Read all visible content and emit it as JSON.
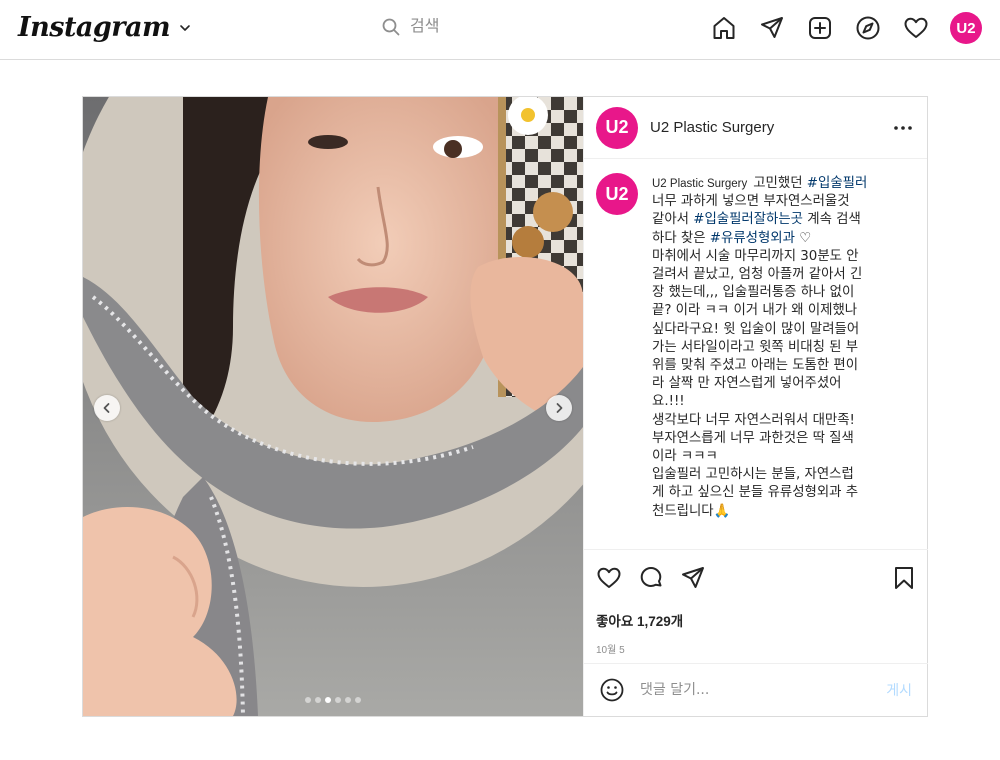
{
  "nav": {
    "logo": "Instagram",
    "search_placeholder": "검색",
    "profile_initials": "U2"
  },
  "post": {
    "account_name": "U2 Plastic Surgery",
    "avatar_initials": "U2",
    "caption": {
      "username": "U2 Plastic Surgery",
      "seg1": "고민했던 ",
      "tag1": "#입술필러",
      "seg2": "\n너무 과하게 넣으면 부자연스러울것\n같아서 ",
      "tag2": "#입술필러잘하는곳",
      "seg3": " 계속 검색\n하다 찾은 ",
      "tag3": "#유류성형외과",
      "seg4": " ♡\n마취에서 시술 마무리까지 30분도 안\n걸려서 끝났고, 엄청 아플꺼 같아서 긴\n장 했는데,,, 입술필러통증 하나 없이\n끝? 이라 ㅋㅋ 이거 내가 왜 이제했나\n싶다라구요! 윗 입술이 많이 말려들어\n가는 서타일이라고 윗쪽 비대칭 된 부\n위를 맞춰 주셨고 아래는 도톰한 편이\n라 살짝 만 자연스럽게 넣어주셨어\n요.!!!\n생각보다 너무 자연스러워서 대만족!\n부자연스릅게 너무 과한것은 딱 질색\n이라 ㅋㅋㅋ\n입술필러 고민하시는 분들, 자연스럽\n게 하고 싶으신 분들 유류성형외과 추\n천드립니다🙏"
    },
    "likes": "좋아요 1,729개",
    "date": "10월 5",
    "comment_placeholder": "댓글 달기...",
    "post_button": "게시",
    "carousel": {
      "total": 6,
      "active_index": 2
    }
  },
  "colors": {
    "brand_pink": "#e8178a",
    "hashtag": "#00376b",
    "post_button_disabled": "#b3dbff",
    "border": "#dbdbdb"
  },
  "icons": [
    "home-icon",
    "direct-icon",
    "new-post-icon",
    "explore-icon",
    "activity-heart-icon",
    "like-icon",
    "comment-icon",
    "share-icon",
    "bookmark-icon",
    "emoji-icon",
    "more-icon",
    "search-icon",
    "chevron-down-icon",
    "chevron-left-icon",
    "chevron-right-icon"
  ]
}
